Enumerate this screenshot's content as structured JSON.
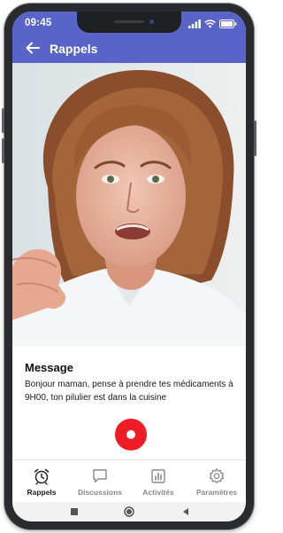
{
  "status_bar": {
    "time": "09:45"
  },
  "app_bar": {
    "title": "Rappels"
  },
  "message": {
    "heading": "Message",
    "body": "Bonjour maman, pense à prendre tes médicaments à 9H00, ton pilulier est dans la cuisine"
  },
  "bottom_nav": {
    "items": [
      {
        "label": "Rappels",
        "icon": "alarm-clock-icon",
        "active": true
      },
      {
        "label": "Discussions",
        "icon": "chat-bubble-icon",
        "active": false
      },
      {
        "label": "Activités",
        "icon": "bar-chart-icon",
        "active": false
      },
      {
        "label": "Paramètres",
        "icon": "gear-icon",
        "active": false
      }
    ]
  },
  "colors": {
    "app_bar": "#5864c7",
    "record_button": "#ee1c25",
    "nav_active": "#222222",
    "nav_inactive": "#8a8a8a"
  }
}
